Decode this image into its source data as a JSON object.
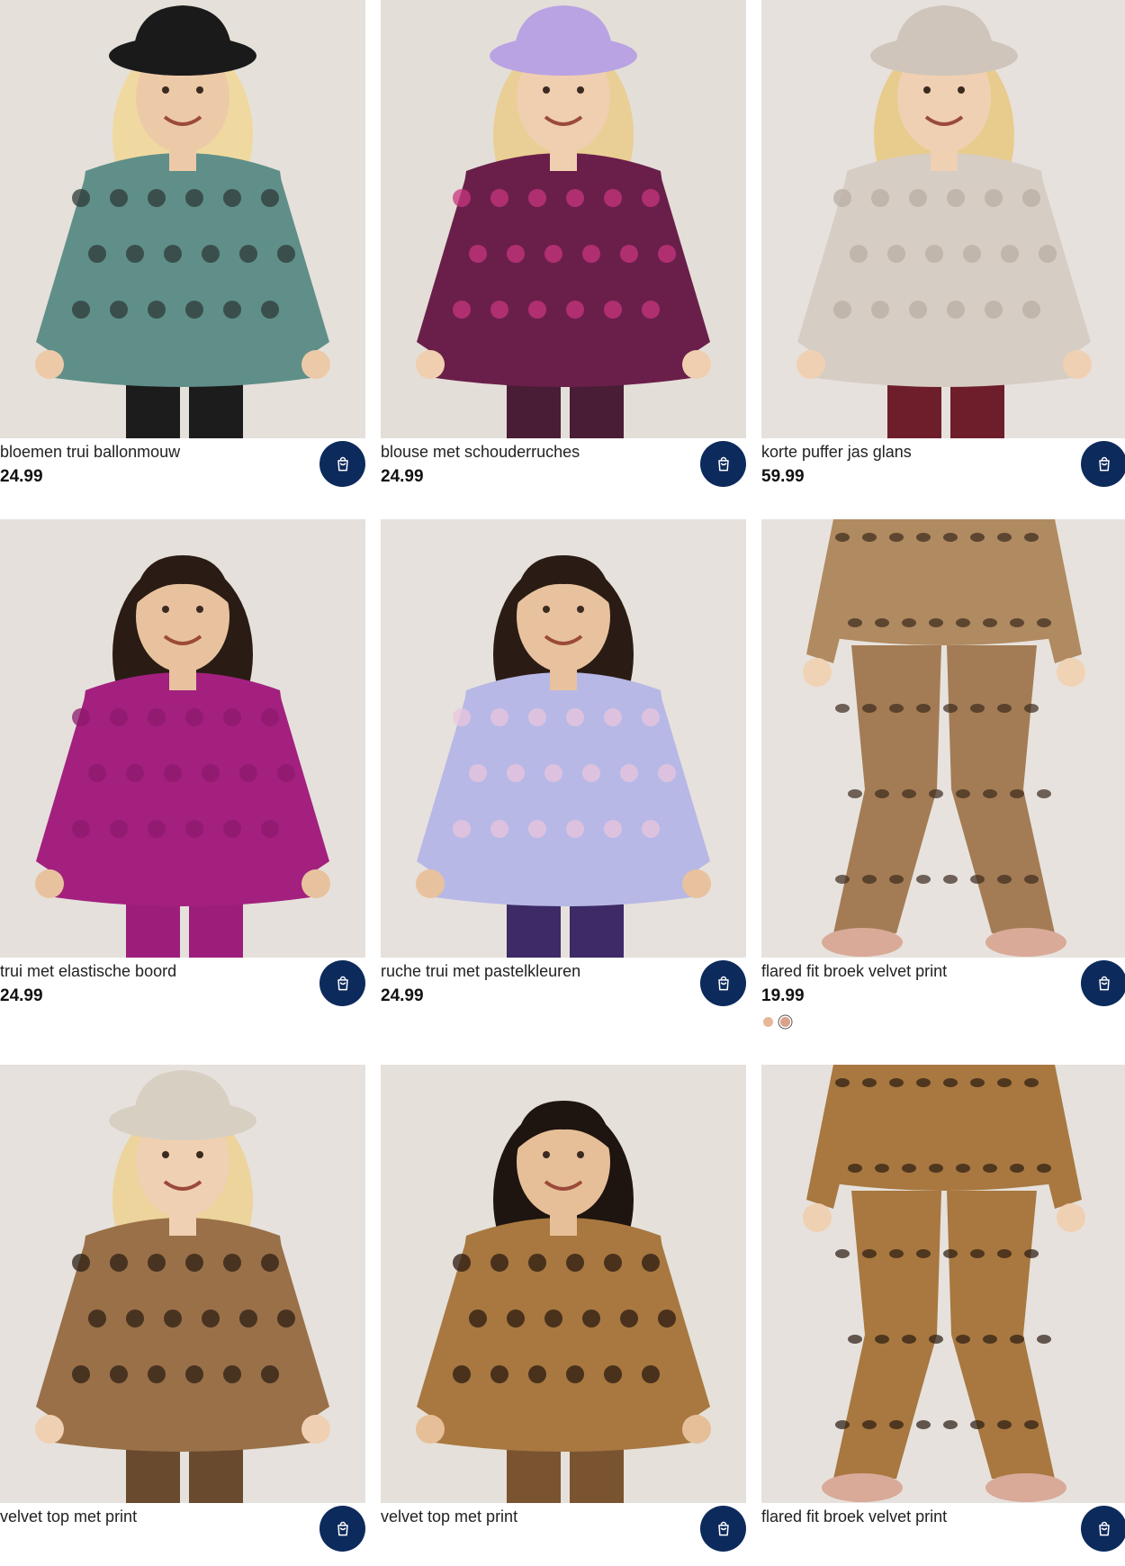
{
  "products": [
    {
      "title": "bloemen trui ballonmouw",
      "price": "24.99",
      "bg": "#e6e0da",
      "garment": "#5f8f88",
      "pattern": "#2e3a38",
      "skin": "#eccaa8",
      "hair": "#f0d9a0",
      "hat": "#1a1a1a",
      "legs": "#1c1c1c"
    },
    {
      "title": "blouse met schouderruches",
      "price": "24.99",
      "bg": "#e4ded8",
      "garment": "#6a1f4a",
      "pattern": "#c8357f",
      "skin": "#efcfb0",
      "hair": "#e9cf95",
      "hat": "#b9a3e3",
      "legs": "#4a1d36"
    },
    {
      "title": "korte puffer jas glans",
      "price": "59.99",
      "bg": "#e6e1dc",
      "garment": "#d6cdc4",
      "pattern": "#b8aea4",
      "skin": "#efd0b2",
      "hair": "#e8cc8e",
      "hat": "#cfc5bb",
      "legs": "#6e1e2b"
    },
    {
      "title": "trui met elastische boord",
      "price": "24.99",
      "bg": "#e5e0db",
      "garment": "#a3207f",
      "pattern": "#8c1a6c",
      "skin": "#e8c29e",
      "hair": "#2a1c14",
      "hat": "",
      "legs": "#9c1e7a"
    },
    {
      "title": "ruche trui met pastelkleuren",
      "price": "24.99",
      "bg": "#e6e1dc",
      "garment": "#b7b8e6",
      "pattern": "#e9c6dc",
      "skin": "#e8c29e",
      "hair": "#2a1c14",
      "hat": "",
      "legs": "#3d2a66"
    },
    {
      "title": "flared fit broek velvet print",
      "price": "19.99",
      "bg": "#e7e2dd",
      "garment": "#b08a60",
      "pattern": "#3a2a1c",
      "skin": "#f0d2b4",
      "hair": "#e8cc8e",
      "hat": "",
      "legs": "#a37c55",
      "swatches": [
        "#e7b79a",
        "#d9a28a"
      ]
    },
    {
      "title": "velvet top met print",
      "price": "",
      "bg": "#e6e1dc",
      "garment": "#9a7048",
      "pattern": "#2c1f14",
      "skin": "#efd0b2",
      "hair": "#ecd49c",
      "hat": "#d8cfc3",
      "legs": "#6a4a2e"
    },
    {
      "title": "velvet top met print",
      "price": "",
      "bg": "#e5e0da",
      "garment": "#a87840",
      "pattern": "#2a1a10",
      "skin": "#e6bf98",
      "hair": "#1e1410",
      "hat": "",
      "legs": "#7a5430"
    },
    {
      "title": "flared fit broek velvet print",
      "price": "",
      "bg": "#e6e1dc",
      "garment": "#a87840",
      "pattern": "#2a1a10",
      "skin": "#efd0b2",
      "hair": "",
      "hat": "",
      "legs": "#a87840"
    }
  ]
}
